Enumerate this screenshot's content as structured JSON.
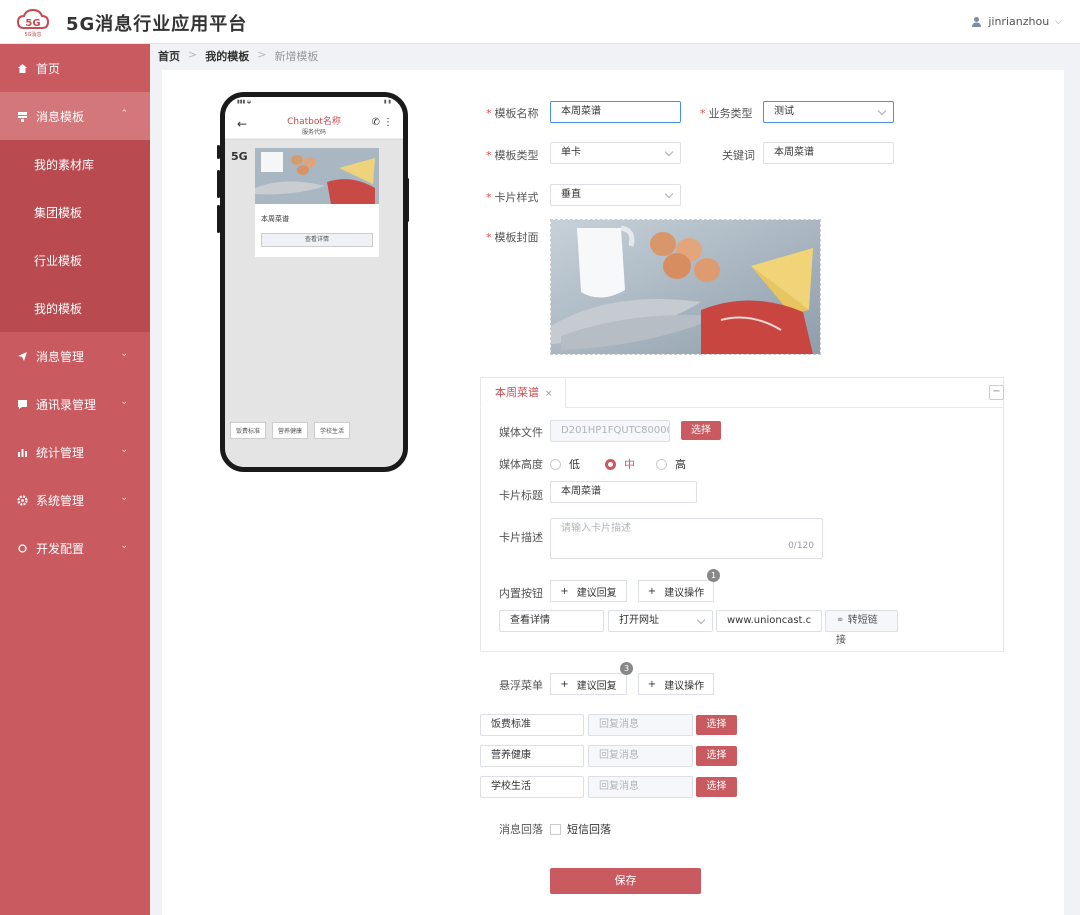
{
  "header": {
    "title": "5G消息行业应用平台",
    "username": "jinrianzhou",
    "logo_text": "5G",
    "logo_sub": "5G消息"
  },
  "sidebar": {
    "items": [
      {
        "label": "首页",
        "icon": "home-icon"
      },
      {
        "label": "消息模板",
        "icon": "template-icon"
      },
      {
        "label": "消息管理",
        "icon": "send-icon"
      },
      {
        "label": "通讯录管理",
        "icon": "chat-icon"
      },
      {
        "label": "统计管理",
        "icon": "chart-icon"
      },
      {
        "label": "系统管理",
        "icon": "gear-icon"
      },
      {
        "label": "开发配置",
        "icon": "dev-icon"
      }
    ],
    "sub": [
      "我的素材库",
      "集团模板",
      "行业模板",
      "我的模板"
    ]
  },
  "breadcrumb": [
    "首页",
    "我的模板",
    "新增模板"
  ],
  "phone": {
    "chatbot_name": "Chatbot名称",
    "service_code": "服务代码",
    "card_title": "本周菜谱",
    "card_button": "查看详情",
    "chips": [
      "饭费标准",
      "营养健康",
      "学校生活"
    ],
    "fiveg": "5G"
  },
  "form": {
    "name_label": "模板名称",
    "name_value": "本周菜谱",
    "biz_label": "业务类型",
    "biz_value": "测试",
    "type_label": "模板类型",
    "type_value": "单卡",
    "keyword_label": "关键词",
    "keyword_value": "本周菜谱",
    "style_label": "卡片样式",
    "style_value": "垂直",
    "cover_label": "模板封面"
  },
  "card_tab": {
    "tab_label": "本周菜谱",
    "media_label": "媒体文件",
    "media_value": "D201HP1FQUTC80000",
    "select_label": "选择",
    "height_label": "媒体高度",
    "heights": [
      "低",
      "中",
      "高"
    ],
    "title_label": "卡片标题",
    "title_value": "本周菜谱",
    "desc_label": "卡片描述",
    "desc_placeholder": "请输入卡片描述",
    "desc_count": "0/120",
    "buttons_label": "内置按钮",
    "suggest_reply": "建议回复",
    "suggest_action": "建议操作",
    "badge": "1",
    "btn_name": "查看详情",
    "btn_action": "打开网址",
    "btn_url": "www.unioncast.c",
    "short_link": "转短链接"
  },
  "floating": {
    "label": "悬浮菜单",
    "badge": "3",
    "suggest_reply": "建议回复",
    "suggest_action": "建议操作",
    "rows": [
      {
        "name": "饭费标准",
        "placeholder": "回复消息"
      },
      {
        "name": "营养健康",
        "placeholder": "回复消息"
      },
      {
        "name": "学校生活",
        "placeholder": "回复消息"
      }
    ],
    "select_label": "选择"
  },
  "fallback": {
    "label": "消息回落",
    "option": "短信回落"
  },
  "save_label": "保存",
  "colors": {
    "accent": "#c95a5f",
    "sidebar": "#c95a5f"
  }
}
